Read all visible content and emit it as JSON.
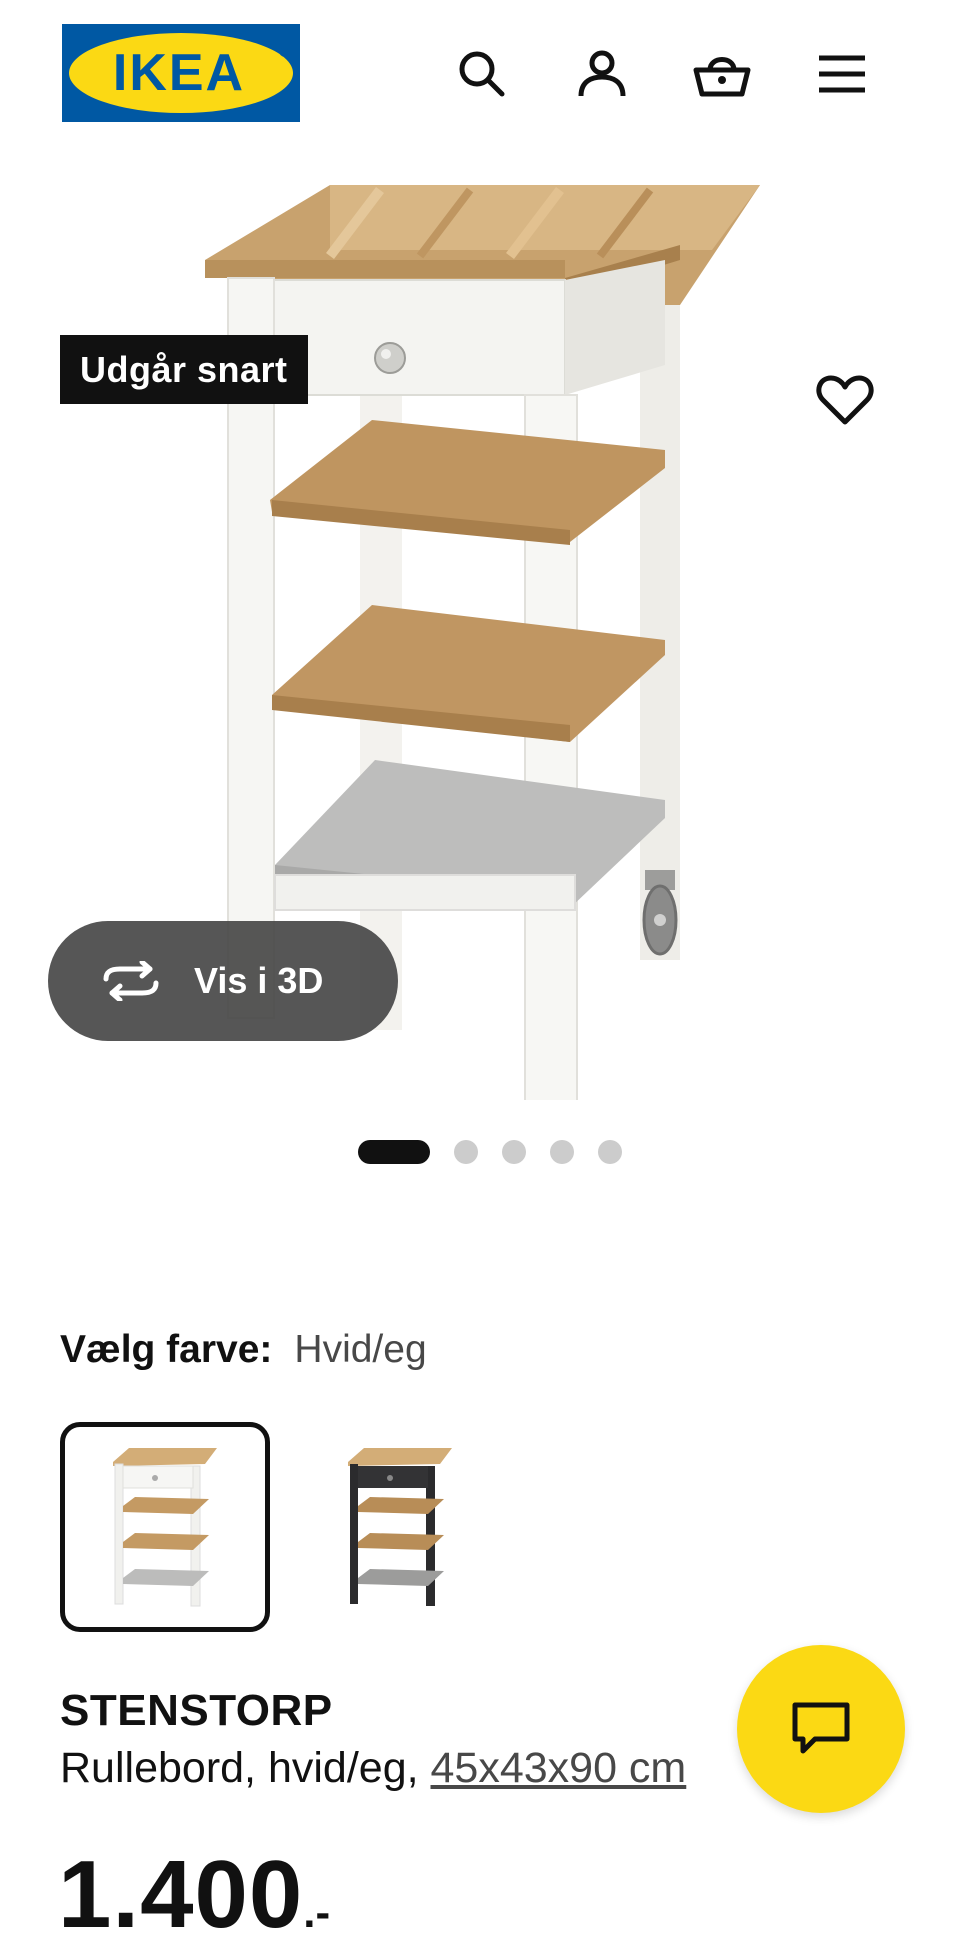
{
  "header": {
    "logo_text": "IKEA",
    "icons": [
      "search-icon",
      "account-icon",
      "basket-icon",
      "menu-icon"
    ]
  },
  "gallery": {
    "badge": "Udgår snart",
    "view3d_label": "Vis i 3D",
    "dots": {
      "total": 5,
      "active": 1
    }
  },
  "color_select": {
    "label": "Vælg farve:",
    "value": "Hvid/eg",
    "options": [
      "Hvid/eg",
      "Sort/eg"
    ],
    "selected": 1
  },
  "product": {
    "name": "STENSTORP",
    "type": "Rullebord, hvid/eg, ",
    "size_link": "45x43x90 cm",
    "price_main": "1.400",
    "price_suffix": ".-"
  },
  "colors": {
    "accent": "#fbd914",
    "brand_blue": "#0058a3",
    "brand_yellow": "#fbd914",
    "text": "#111111"
  }
}
